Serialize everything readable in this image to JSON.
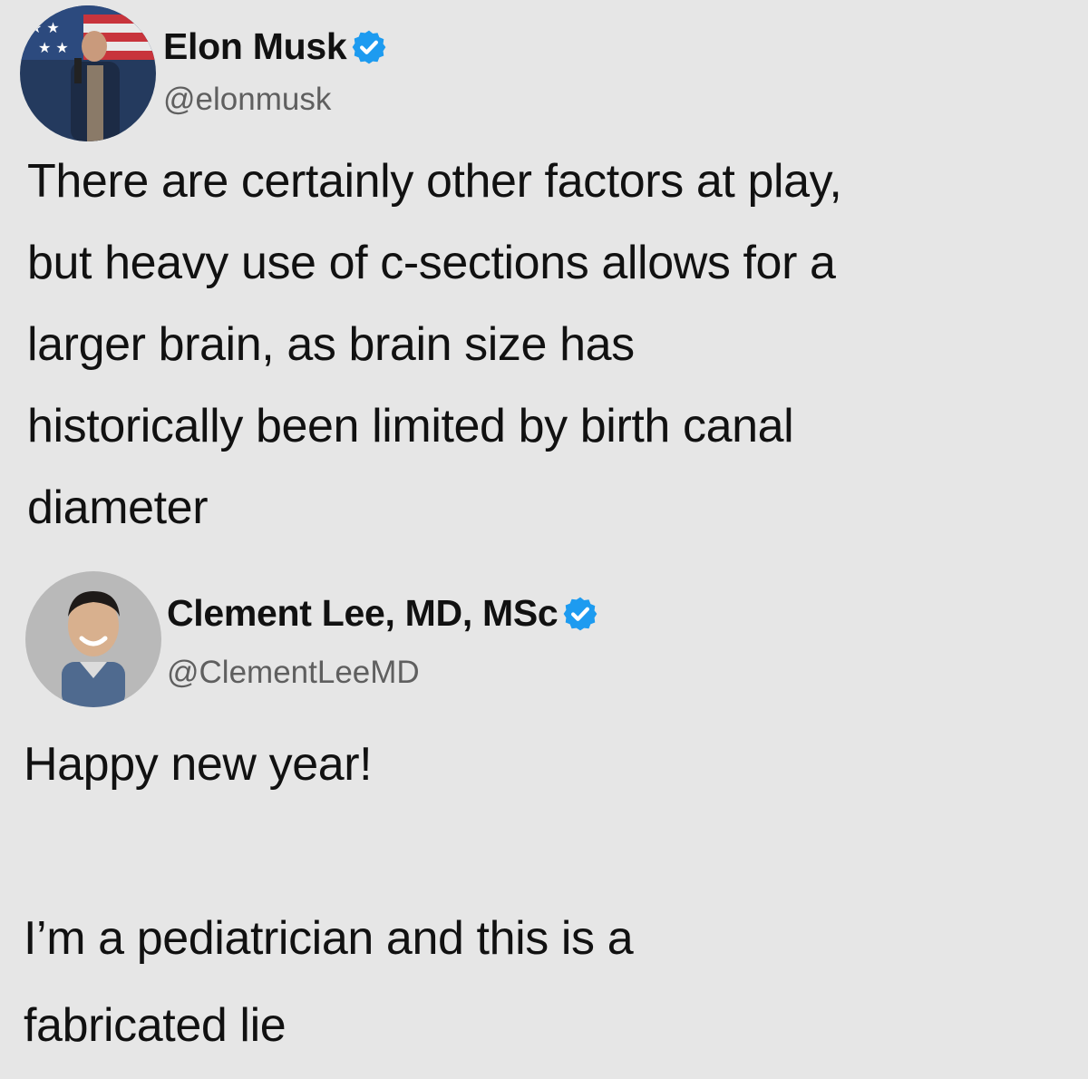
{
  "tweets": [
    {
      "display_name": "Elon Musk",
      "handle": "@elonmusk",
      "verified_icon": "verified-check-icon",
      "text": "There are certainly other factors at play,\nbut heavy use of c-sections allows for a\nlarger brain, as brain size has\nhistorically been limited by birth canal\ndiameter"
    },
    {
      "display_name": "Clement Lee, MD, MSc",
      "handle": "@ClementLeeMD",
      "verified_icon": "verified-check-icon",
      "text": "Happy new year!\n\nI’m a pediatrician and this is a\nfabricated lie"
    }
  ],
  "colors": {
    "background": "#e6e6e6",
    "verified_blue": "#1d9bf0",
    "handle_gray": "#5f5f5f"
  }
}
